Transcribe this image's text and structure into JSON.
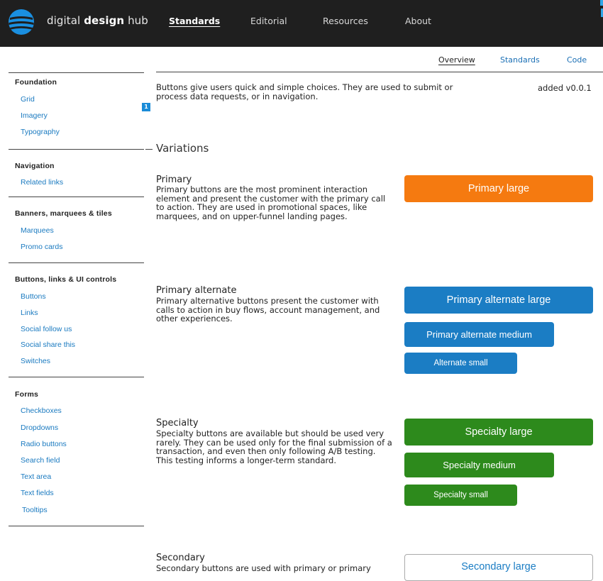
{
  "header": {
    "brand_light": "digital",
    "brand_bold": "design",
    "brand_tail": "hub",
    "nav": [
      {
        "label": "Standards"
      },
      {
        "label": "Editorial"
      },
      {
        "label": "Resources"
      },
      {
        "label": "About"
      }
    ]
  },
  "subnav": {
    "items": [
      {
        "label": "Overview"
      },
      {
        "label": "Standards"
      },
      {
        "label": "Code"
      }
    ]
  },
  "sidebar": {
    "groups": [
      {
        "heading": "Foundation",
        "links": [
          "Grid",
          "Imagery",
          "Typography"
        ]
      },
      {
        "heading": "Navigation",
        "links": [
          "Related links"
        ]
      },
      {
        "heading": "Banners, marquees & tiles",
        "links": [
          "Marquees",
          "Promo cards"
        ]
      },
      {
        "heading": "Buttons, links & UI controls",
        "links": [
          "Buttons",
          "Links",
          "Social follow us",
          "Social share this",
          "Switches"
        ]
      },
      {
        "heading": "Forms",
        "links": [
          "Checkboxes",
          "Dropdowns",
          "Radio buttons",
          "Search field",
          "Text area",
          "Text fields",
          "Tooltips"
        ]
      }
    ],
    "badge": "1"
  },
  "main": {
    "intro": "Buttons give users quick and simple choices. They are used to submit or process data requests, or in navigation.",
    "version": "added v0.0.1",
    "variations_title": "Variations",
    "sections": [
      {
        "title": "Primary",
        "desc": "Primary buttons are the most prominent interaction element and present the customer with the primary call to action. They are used in promotional spaces, like marquees, and on upper-funnel landing pages.",
        "buttons": [
          "Primary large"
        ]
      },
      {
        "title": "Primary alternate",
        "desc": "Primary alternative buttons present the customer with calls to action in buy flows, account management, and other experiences.",
        "buttons": [
          "Primary alternate large",
          "Primary alternate medium",
          "Alternate small"
        ]
      },
      {
        "title": "Specialty",
        "desc": "Specialty buttons are available but should be used very rarely. They can be used only for the final submission of a transaction, and even then only following A/B testing. This testing informs a longer-term standard.",
        "buttons": [
          "Specialty large",
          "Specialty medium",
          "Specialty small"
        ]
      },
      {
        "title": "Secondary",
        "desc": "Secondary buttons are used with primary or primary",
        "buttons": [
          "Secondary large"
        ]
      }
    ]
  },
  "colors": {
    "header_bg": "#1f1f1f",
    "link": "#1a7ac0",
    "primary_orange": "#f57a10",
    "alternate_blue": "#1b7dc4",
    "specialty_green": "#2d8a1c"
  }
}
